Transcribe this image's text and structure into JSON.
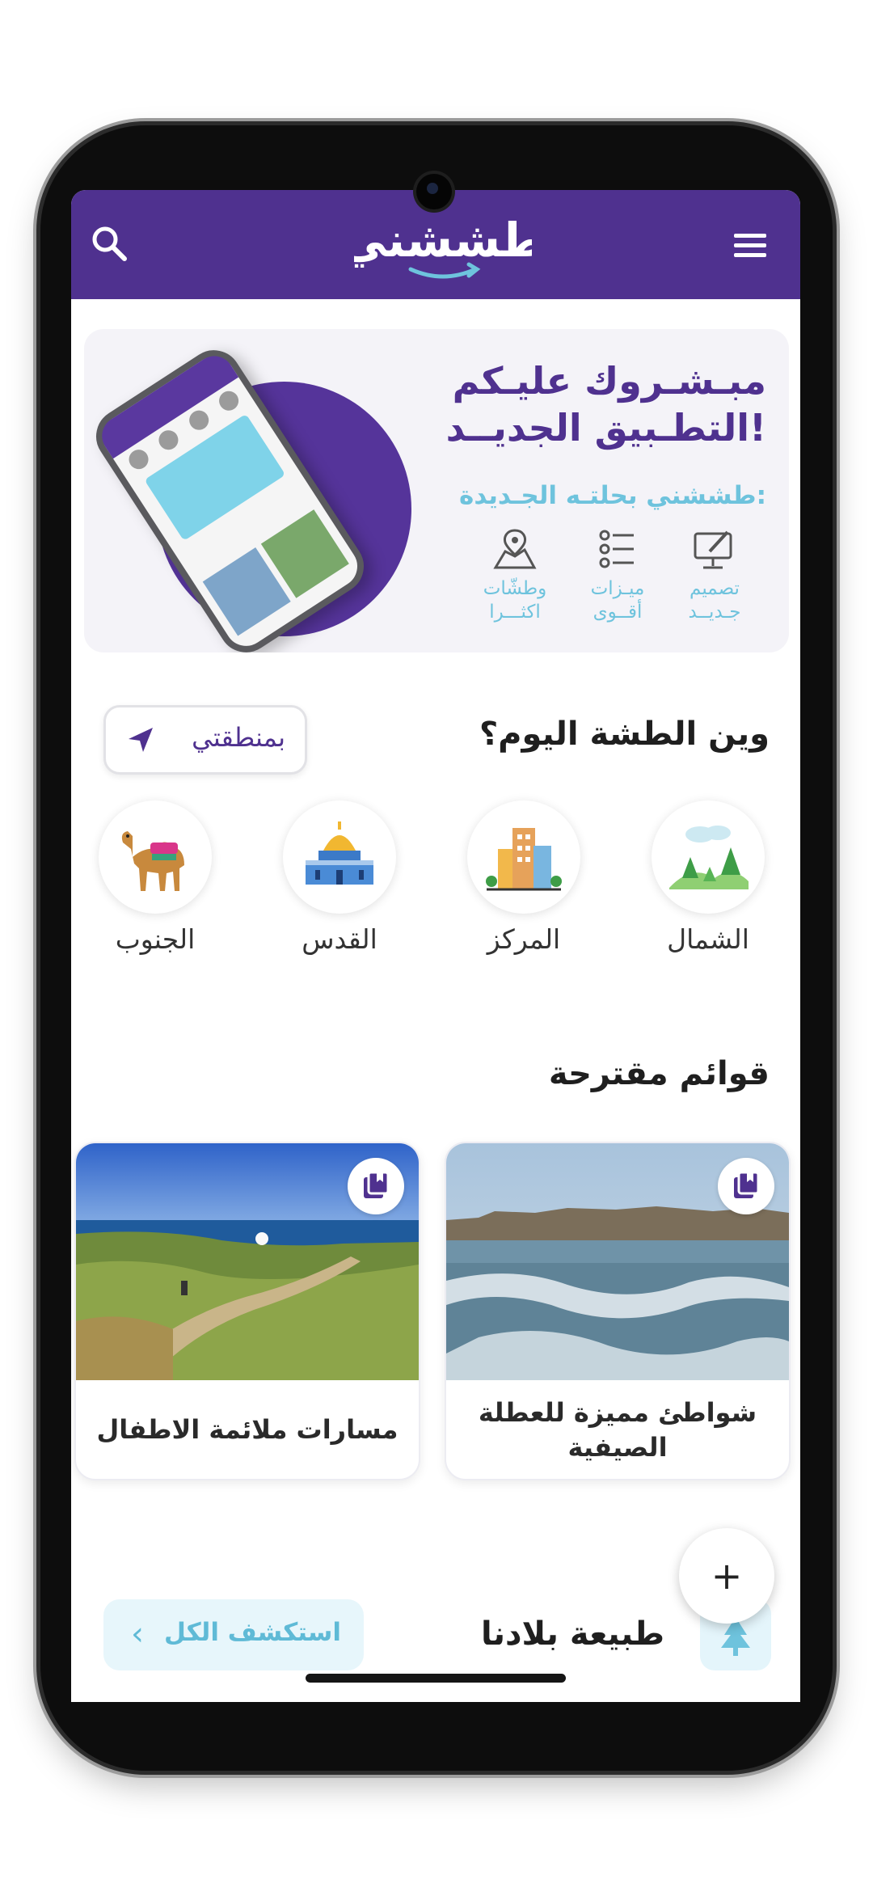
{
  "header": {
    "logo_text": "طششني",
    "search_icon": "search-icon",
    "menu_icon": "hamburger-menu-icon",
    "colors": {
      "bar": "#4f318f",
      "accent": "#6ec3dd"
    }
  },
  "banner": {
    "title_line1": "مبـشـروك عليـكم",
    "title_line2": "التطـبيق الجديــد!",
    "subtitle": "طششني بحلتـه الجـديدة:",
    "features": [
      {
        "icon": "design-monitor-icon",
        "label_top": "تصميم",
        "label_bottom": "جـديــد"
      },
      {
        "icon": "features-list-icon",
        "label_top": "ميـزات",
        "label_bottom": "أقــوى"
      },
      {
        "icon": "map-pin-icon",
        "label_top": "وطشّات",
        "label_bottom": "اكثـــرا"
      }
    ]
  },
  "regions_section": {
    "title": "وين الطشة اليوم؟",
    "location_button": "بمنطقتي",
    "regions": [
      {
        "label": "الشمال",
        "icon": "north-hills-icon"
      },
      {
        "label": "المركز",
        "icon": "center-buildings-icon"
      },
      {
        "label": "القدس",
        "icon": "jerusalem-dome-icon"
      },
      {
        "label": "الجنوب",
        "icon": "south-camel-icon"
      }
    ]
  },
  "lists_section": {
    "title": "قوائم مقترحة",
    "cards": [
      {
        "title": "شواطئ مميزة للعطلة الصيفية",
        "image": "beach-photo"
      },
      {
        "title": "مسارات ملائمة الاطفال",
        "image": "trail-photo"
      }
    ]
  },
  "nature_section": {
    "title": "طبيعة بلادنا",
    "explore_button": "استكشف الكل",
    "fab_label": "+"
  }
}
